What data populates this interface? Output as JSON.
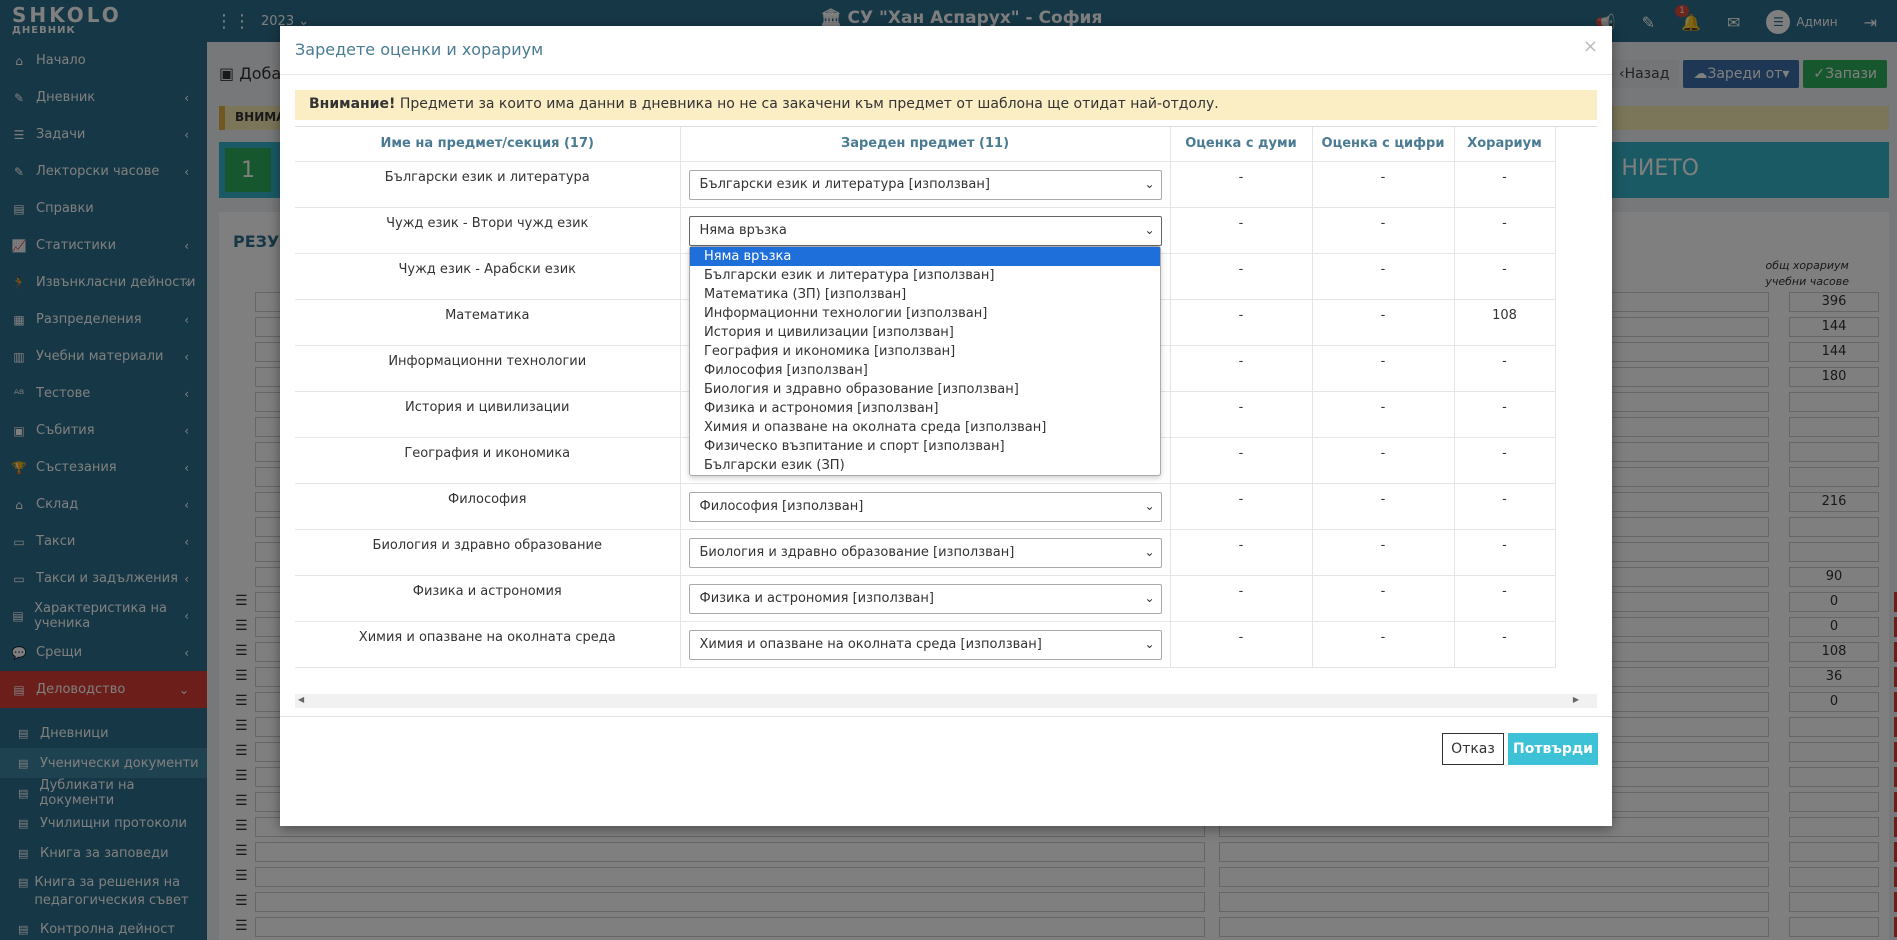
{
  "topbar": {
    "logo_main": "SHKOLO",
    "logo_sub": "ДНЕВНИК",
    "year": "2023",
    "school": "СУ \"Хан Аспарух\" - София",
    "notification_count": "1",
    "user": "Админ"
  },
  "sidebar": {
    "items": [
      {
        "label": "Начало",
        "icon": "home-icon"
      },
      {
        "label": "Дневник",
        "icon": "edit-icon"
      },
      {
        "label": "Задачи",
        "icon": "list-icon"
      },
      {
        "label": "Лекторски часове",
        "icon": "edit-icon"
      },
      {
        "label": "Справки",
        "icon": "doc-icon"
      },
      {
        "label": "Статистики",
        "icon": "chart-icon"
      },
      {
        "label": "Извънкласни дейности",
        "icon": "run-icon"
      },
      {
        "label": "Разпределения",
        "icon": "grid-icon"
      },
      {
        "label": "Учебни материали",
        "icon": "books-icon"
      },
      {
        "label": "Тестове",
        "icon": "abc-icon"
      },
      {
        "label": "Събития",
        "icon": "calendar-icon"
      },
      {
        "label": "Състезания",
        "icon": "trophy-icon"
      },
      {
        "label": "Склад",
        "icon": "box-icon"
      },
      {
        "label": "Такси",
        "icon": "money-icon"
      },
      {
        "label": "Такси и задължения",
        "icon": "money-icon"
      },
      {
        "label": "Характеристика на ученика",
        "icon": "doc-icon"
      },
      {
        "label": "Срещи",
        "icon": "chat-icon"
      },
      {
        "label": "Деловодство",
        "icon": "doc-icon"
      }
    ],
    "subitems": [
      {
        "label": "Дневници"
      },
      {
        "label": "Ученически документи"
      },
      {
        "label": "Дубликати на документи"
      },
      {
        "label": "Училищни протоколи"
      },
      {
        "label": "Книга за заповеди"
      },
      {
        "label": "Книга за решения на педагогическия съвет"
      },
      {
        "label": "Контролна дейност"
      }
    ]
  },
  "background": {
    "title_fragment": "Доба",
    "back_label": "Назад",
    "load_from_label": "Зареди от",
    "save_label": "Запази",
    "warn_fragment": "ВНИМА",
    "step_number": "1",
    "step_text_fragment": "НИЕТО",
    "result_fragment": "РЕЗУЛ",
    "col_header_line1": "общ хорариум",
    "col_header_line2": "учебни часове",
    "hours": [
      "396",
      "144",
      "144",
      "180",
      "",
      "",
      "",
      "",
      "216",
      "",
      "",
      "90",
      "0",
      "0",
      "108",
      "36",
      "0",
      "",
      "",
      "",
      "",
      "",
      "",
      "",
      "",
      ""
    ]
  },
  "modal": {
    "title": "Заредете оценки и хорариум",
    "close": "×",
    "notice_bold": "Внимание!",
    "notice_text": " Предмети за които има данни в дневника но не са закачени към предмет от шаблона ще отидат най-отдолу.",
    "columns": {
      "name": "Име на предмет/секция (17)",
      "loaded": "Зареден предмет (11)",
      "grade_words": "Оценка с думи",
      "grade_digits": "Оценка с цифри",
      "hours": "Хорариум"
    },
    "rows": [
      {
        "name": "Български език и литература",
        "loaded": "Български език и литература [използван]",
        "words": "-",
        "digits": "-",
        "hours": "-"
      },
      {
        "name": "Чужд език - Втори чужд език",
        "loaded": "Няма връзка",
        "words": "-",
        "digits": "-",
        "hours": "-"
      },
      {
        "name": "Чужд език - Арабски език",
        "loaded": "",
        "words": "-",
        "digits": "-",
        "hours": "-"
      },
      {
        "name": "Математика",
        "loaded": "",
        "words": "-",
        "digits": "-",
        "hours": "108"
      },
      {
        "name": "Информационни технологии",
        "loaded": "",
        "words": "-",
        "digits": "-",
        "hours": "-"
      },
      {
        "name": "История и цивилизации",
        "loaded": "",
        "words": "-",
        "digits": "-",
        "hours": "-"
      },
      {
        "name": "География и икономика",
        "loaded": "",
        "words": "-",
        "digits": "-",
        "hours": "-"
      },
      {
        "name": "Философия",
        "loaded": "Философия [използван]",
        "words": "-",
        "digits": "-",
        "hours": "-"
      },
      {
        "name": "Биология и здравно образование",
        "loaded": "Биология и здравно образование [използван]",
        "words": "-",
        "digits": "-",
        "hours": "-"
      },
      {
        "name": "Физика и астрономия",
        "loaded": "Физика и астрономия [използван]",
        "words": "-",
        "digits": "-",
        "hours": "-"
      },
      {
        "name": "Химия и опазване на околната среда",
        "loaded": "Химия и опазване на околната среда [използван]",
        "words": "-",
        "digits": "-",
        "hours": "-"
      }
    ],
    "dropdown_options": [
      "Няма връзка",
      "Български език и литература [използван]",
      "Математика (ЗП) [използван]",
      "Информационни технологии [използван]",
      "История и цивилизации [използван]",
      "География и икономика [използван]",
      "Философия [използван]",
      "Биология и здравно образование [използван]",
      "Физика и астрономия [използван]",
      "Химия и опазване на околната среда [използван]",
      "Физическо възпитание и спорт [използван]",
      "Български език (ЗП)"
    ],
    "cancel_label": "Отказ",
    "confirm_label": "Потвърди"
  }
}
